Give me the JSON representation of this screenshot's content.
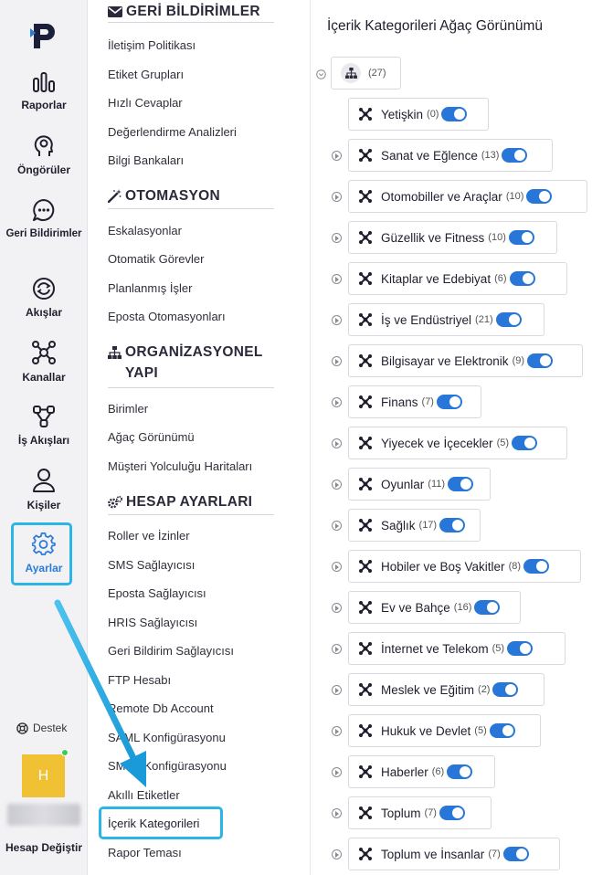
{
  "rail": {
    "items": [
      {
        "label": "Raporlar",
        "icon": "bar-chart-icon"
      },
      {
        "label": "Öngörüler",
        "icon": "head-insight-icon"
      },
      {
        "label": "Geri Bildirimler",
        "icon": "chat-bubble-icon"
      },
      {
        "label": "Akışlar",
        "icon": "sync-icon"
      },
      {
        "label": "Kanallar",
        "icon": "network-icon"
      },
      {
        "label": "İş Akışları",
        "icon": "workflow-icon"
      },
      {
        "label": "Kişiler",
        "icon": "person-icon"
      },
      {
        "label": "Ayarlar",
        "icon": "gear-icon"
      }
    ],
    "support_label": "Destek",
    "avatar_initial": "H",
    "switch_account_label": "Hesap Değiştir"
  },
  "menu": {
    "sections": [
      {
        "title": "GERİ BİLDİRİMLER",
        "icon": "envelope-icon",
        "items": [
          "İletişim Politikası",
          "Etiket Grupları",
          "Hızlı Cevaplar",
          "Değerlendirme Analizleri",
          "Bilgi Bankaları"
        ]
      },
      {
        "title": "OTOMASYON",
        "icon": "magic-wand-icon",
        "items": [
          "Eskalasyonlar",
          "Otomatik Görevler",
          "Planlanmış İşler",
          "Eposta Otomasyonları"
        ]
      },
      {
        "title": "ORGANİZASYONEL YAPI",
        "icon": "org-chart-icon",
        "items": [
          "Birimler",
          "Ağaç Görünümü",
          "Müşteri Yolculuğu Haritaları"
        ]
      },
      {
        "title": "HESAP AYARLARI",
        "icon": "cogs-icon",
        "items": [
          "Roller ve İzinler",
          "SMS Sağlayıcısı",
          "Eposta Sağlayıcısı",
          "HRIS Sağlayıcısı",
          "Geri Bildirim Sağlayıcısı",
          "FTP Hesabı",
          "Remote Db Account",
          "SAML Konfigürasyonu",
          "SMTP Konfigürasyonu",
          "Akıllı Etiketler",
          "İçerik Kategorileri",
          "Rapor Teması"
        ]
      }
    ]
  },
  "tree": {
    "title": "İçerik Kategorileri Ağaç Görünümü",
    "root": {
      "count": "(27)"
    },
    "nodes": [
      {
        "label": "Yetişkin",
        "count": "(0)",
        "enabled": true
      },
      {
        "label": "Sanat ve Eğlence",
        "count": "(13)",
        "enabled": true
      },
      {
        "label": "Otomobiller ve Araçlar",
        "count": "(10)",
        "enabled": true
      },
      {
        "label": "Güzellik ve Fitness",
        "count": "(10)",
        "enabled": true
      },
      {
        "label": "Kitaplar ve Edebiyat",
        "count": "(6)",
        "enabled": true
      },
      {
        "label": "İş ve Endüstriyel",
        "count": "(21)",
        "enabled": true
      },
      {
        "label": "Bilgisayar ve Elektronik",
        "count": "(9)",
        "enabled": true
      },
      {
        "label": "Finans",
        "count": "(7)",
        "enabled": true
      },
      {
        "label": "Yiyecek ve İçecekler",
        "count": "(5)",
        "enabled": true
      },
      {
        "label": "Oyunlar",
        "count": "(11)",
        "enabled": true
      },
      {
        "label": "Sağlık",
        "count": "(17)",
        "enabled": true
      },
      {
        "label": "Hobiler ve Boş Vakitler",
        "count": "(8)",
        "enabled": true
      },
      {
        "label": "Ev ve Bahçe",
        "count": "(16)",
        "enabled": true
      },
      {
        "label": "İnternet ve Telekom",
        "count": "(5)",
        "enabled": true
      },
      {
        "label": "Meslek ve Eğitim",
        "count": "(2)",
        "enabled": true
      },
      {
        "label": "Hukuk ve Devlet",
        "count": "(5)",
        "enabled": true
      },
      {
        "label": "Haberler",
        "count": "(6)",
        "enabled": true
      },
      {
        "label": "Toplum",
        "count": "(7)",
        "enabled": true
      },
      {
        "label": "Toplum ve İnsanlar",
        "count": "(7)",
        "enabled": true
      }
    ]
  },
  "colors": {
    "accent": "#2877d8",
    "highlight": "#2bb4e6"
  }
}
